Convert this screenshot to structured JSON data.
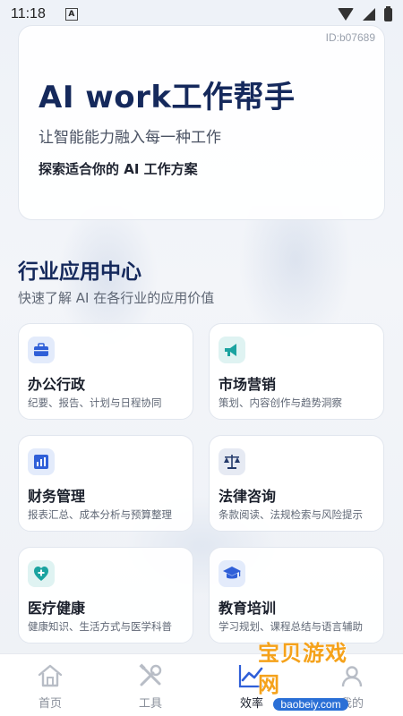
{
  "status_bar": {
    "time": "11:18",
    "notification_icon": "A"
  },
  "hero": {
    "id_label": "ID:b07689",
    "title": "AI work工作帮手",
    "subtitle": "让智能能力融入每一种工作",
    "cta": "探索适合你的 AI 工作方案"
  },
  "section": {
    "title": "行业应用中心",
    "subtitle": "快速了解 AI 在各行业的应用价值"
  },
  "cards": [
    {
      "title": "办公行政",
      "desc": "纪要、报告、计划与日程协同",
      "icon": "briefcase-icon",
      "color": "#2f5fd8"
    },
    {
      "title": "市场营销",
      "desc": "策划、内容创作与趋势洞察",
      "icon": "megaphone-icon",
      "color": "#1aa3a0"
    },
    {
      "title": "财务管理",
      "desc": "报表汇总、成本分析与预算整理",
      "icon": "bar-chart-icon",
      "color": "#2f5fd8"
    },
    {
      "title": "法律咨询",
      "desc": "条款阅读、法规检索与风险提示",
      "icon": "scale-icon",
      "color": "#243a6b"
    },
    {
      "title": "医疗健康",
      "desc": "健康知识、生活方式与医学科普",
      "icon": "medical-cross-icon",
      "color": "#1aa3a0"
    },
    {
      "title": "教育培训",
      "desc": "学习规划、课程总结与语言辅助",
      "icon": "graduation-cap-icon",
      "color": "#2f5fd8"
    }
  ],
  "tabbar": {
    "items": [
      {
        "label": "首页",
        "icon": "home-icon"
      },
      {
        "label": "工具",
        "icon": "tools-icon"
      },
      {
        "label": "效率",
        "icon": "efficiency-chart-icon"
      },
      {
        "label": "我的",
        "icon": "profile-icon"
      }
    ],
    "active_index": 2
  },
  "watermark": {
    "text": "宝贝游戏网",
    "url": "baobeiy.com"
  }
}
